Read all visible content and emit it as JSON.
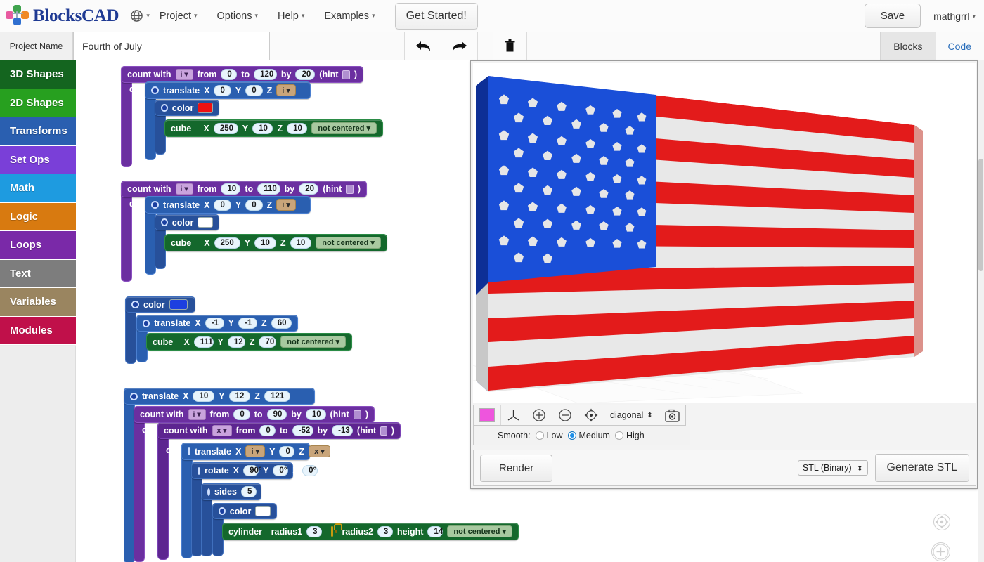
{
  "app": {
    "name": "BlocksCAD",
    "logo_colors": [
      "#e85aa0",
      "#3fa34d",
      "#f08a24",
      "#2f6fd0"
    ]
  },
  "topnav": {
    "globe_icon": "globe-icon",
    "items": [
      {
        "label": "Project",
        "caret": true
      },
      {
        "label": "Options",
        "caret": true
      },
      {
        "label": "Help",
        "caret": true
      },
      {
        "label": "Examples",
        "caret": true
      }
    ],
    "get_started": "Get Started!",
    "save": "Save",
    "user": "mathgrrl"
  },
  "subbar": {
    "project_name_label": "Project Name",
    "project_name_value": "Fourth of July",
    "project_name_placeholder": "Project Name",
    "undo_icon": "undo-arrow-icon",
    "redo_icon": "redo-arrow-icon",
    "trash_icon": "trash-can-icon",
    "tabs": [
      {
        "label": "Blocks",
        "active": true
      },
      {
        "label": "Code",
        "active": false
      }
    ]
  },
  "sidebar": {
    "items": [
      {
        "label": "3D Shapes",
        "color": "#14651f"
      },
      {
        "label": "2D Shapes",
        "color": "#27a01f"
      },
      {
        "label": "Transforms",
        "color": "#2a5fb0"
      },
      {
        "label": "Set Ops",
        "color": "#7a3fd8"
      },
      {
        "label": "Math",
        "color": "#1e9be0"
      },
      {
        "label": "Logic",
        "color": "#d87a10"
      },
      {
        "label": "Loops",
        "color": "#7a29a8"
      },
      {
        "label": "Text",
        "color": "#7d7d7d"
      },
      {
        "label": "Variables",
        "color": "#9a8560"
      },
      {
        "label": "Modules",
        "color": "#c0104a"
      }
    ]
  },
  "blocks": {
    "group1": {
      "loop": {
        "keyword": "count with",
        "var": "i",
        "from_label": "from",
        "from": "0",
        "to_label": "to",
        "to": "120",
        "by_label": "by",
        "by": "20",
        "hint": "(hint",
        "hint_close": ")"
      },
      "do_label": "do",
      "translate": {
        "label": "translate",
        "x_label": "X",
        "x": "0",
        "y_label": "Y",
        "y": "0",
        "z_label": "Z",
        "z_var": "i"
      },
      "color": {
        "label": "color",
        "value": "#ee1111"
      },
      "cube": {
        "label": "cube",
        "x_label": "X",
        "x": "250",
        "y_label": "Y",
        "y": "10",
        "z_label": "Z",
        "z": "10",
        "center": "not centered"
      }
    },
    "group2": {
      "loop": {
        "keyword": "count with",
        "var": "i",
        "from_label": "from",
        "from": "10",
        "to_label": "to",
        "to": "110",
        "by_label": "by",
        "by": "20",
        "hint": "(hint",
        "hint_close": ")"
      },
      "do_label": "do",
      "translate": {
        "label": "translate",
        "x_label": "X",
        "x": "0",
        "y_label": "Y",
        "y": "0",
        "z_label": "Z",
        "z_var": "i"
      },
      "color": {
        "label": "color",
        "value": "#ffffff"
      },
      "cube": {
        "label": "cube",
        "x_label": "X",
        "x": "250",
        "y_label": "Y",
        "y": "10",
        "z_label": "Z",
        "z": "10",
        "center": "not centered"
      }
    },
    "group3": {
      "color": {
        "label": "color",
        "value": "#1c3fe0"
      },
      "translate": {
        "label": "translate",
        "x_label": "X",
        "x": "-1",
        "y_label": "Y",
        "y": "-1",
        "z_label": "Z",
        "z": "60"
      },
      "cube": {
        "label": "cube",
        "x_label": "X",
        "x": "111",
        "y_label": "Y",
        "y": "12",
        "z_label": "Z",
        "z": "70",
        "center": "not centered"
      }
    },
    "group4": {
      "translate_outer": {
        "label": "translate",
        "x_label": "X",
        "x": "10",
        "y_label": "Y",
        "y": "12",
        "z_label": "Z",
        "z": "121"
      },
      "loop_outer": {
        "keyword": "count with",
        "var": "i",
        "from_label": "from",
        "from": "0",
        "to_label": "to",
        "to": "90",
        "by_label": "by",
        "by": "10",
        "hint": "(hint",
        "hint_close": ")"
      },
      "do_label": "do",
      "loop_inner": {
        "keyword": "count with",
        "var": "x",
        "from_label": "from",
        "from": "0",
        "to_label": "to",
        "to": "-52",
        "by_label": "by",
        "by": "-13",
        "hint": "(hint",
        "hint_close": ")"
      },
      "do_label2": "do",
      "translate_inner": {
        "label": "translate",
        "x_label": "X",
        "x_var": "i",
        "y_label": "Y",
        "y": "0",
        "z_label": "Z",
        "z_var": "x"
      },
      "rotate": {
        "label": "rotate",
        "x_label": "X",
        "x": "90°",
        "y_label": "Y",
        "y": "0°",
        "z_label": "Z",
        "z": "0°"
      },
      "sides": {
        "label": "sides",
        "value": "5"
      },
      "color": {
        "label": "color",
        "value": "#ffffff"
      },
      "cylinder": {
        "label": "cylinder",
        "r1_label": "radius1",
        "r1": "3",
        "lock_icon": "lock-icon",
        "r2_label": "radius2",
        "r2": "3",
        "h_label": "height",
        "h": "14",
        "center": "not centered"
      }
    }
  },
  "viewer": {
    "toolbar": {
      "color_swatch": "#ee55dd",
      "axes_icon": "axes-icon",
      "zoom_in_icon": "zoom-in-icon",
      "zoom_out_icon": "zoom-out-icon",
      "center_icon": "center-target-icon",
      "view_select": "diagonal",
      "camera_icon": "camera-icon"
    },
    "smooth": {
      "label": "Smooth:",
      "options": [
        {
          "label": "Low",
          "selected": false
        },
        {
          "label": "Medium",
          "selected": true
        },
        {
          "label": "High",
          "selected": false
        }
      ]
    },
    "render_button": "Render",
    "stl_format": "STL (Binary)",
    "generate_button": "Generate STL",
    "model": {
      "description": "United States flag, extruded 3D slab, diagonal perspective view",
      "canton_color": "#1a4fd8",
      "stripe_red": "#e31b1b",
      "stripe_white": "#e8e8e8",
      "star_count": 50,
      "stripe_count": 13
    }
  },
  "corner": {
    "center_icon": "center-target-icon",
    "zoom_in_icon": "zoom-in-circle-icon"
  }
}
